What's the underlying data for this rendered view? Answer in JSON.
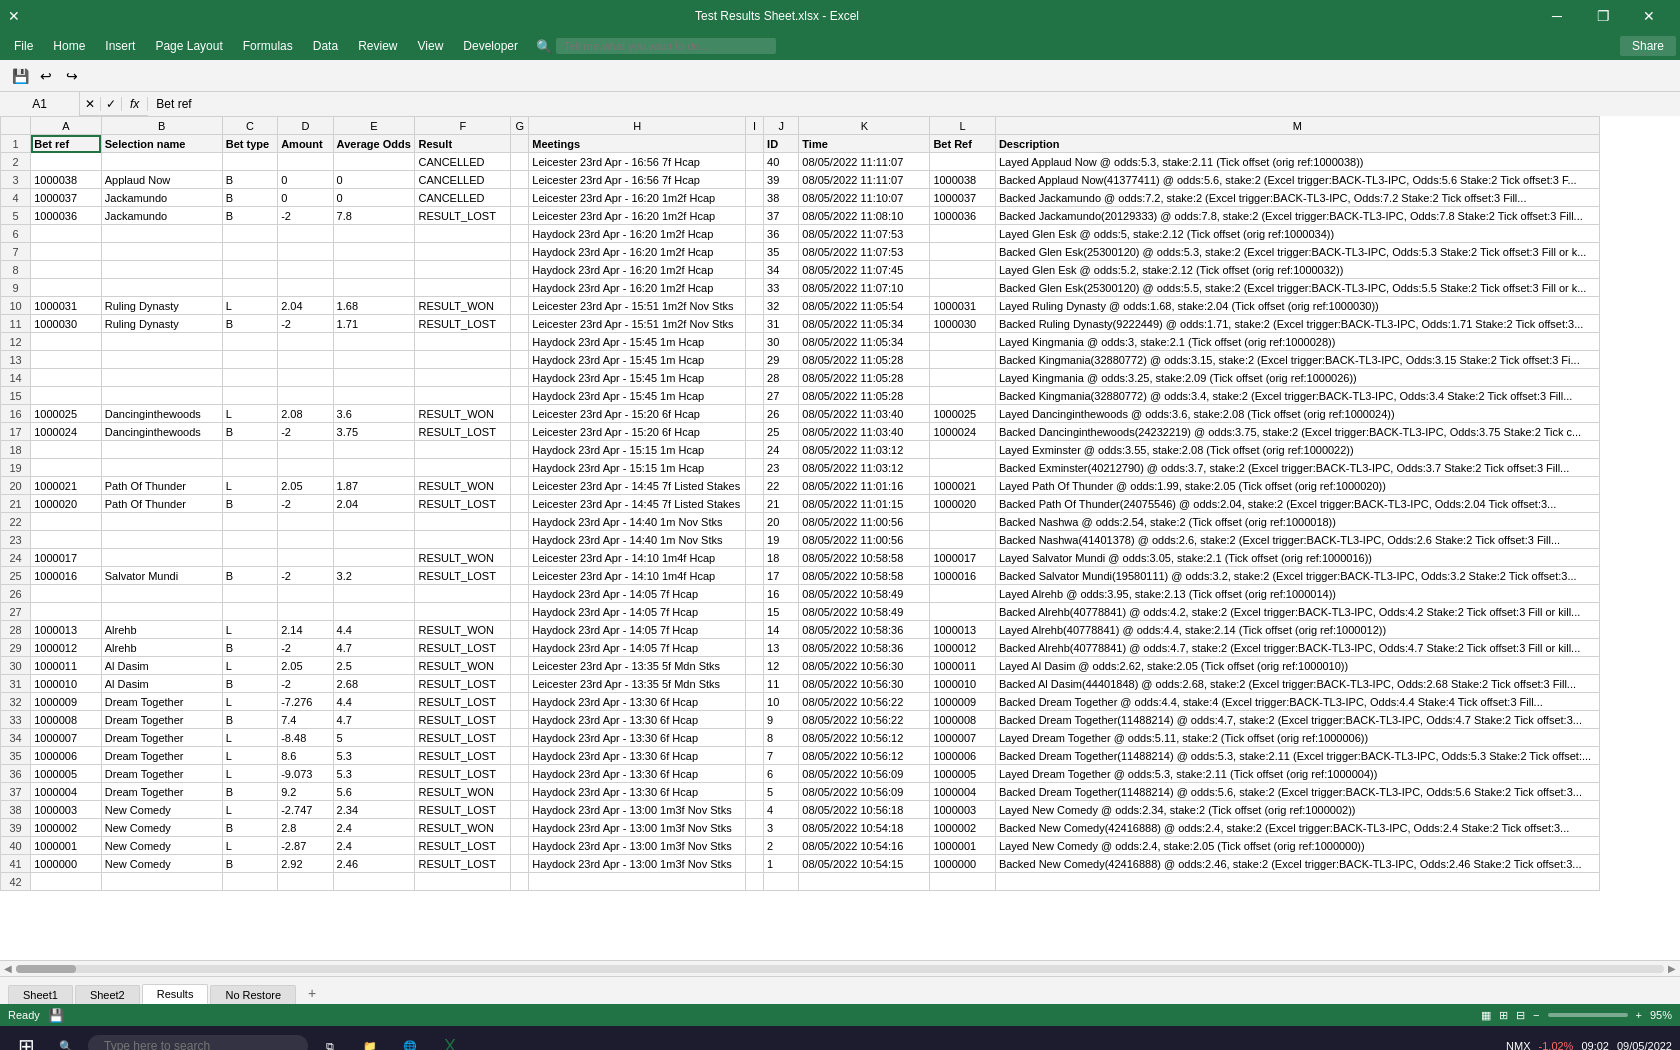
{
  "titleBar": {
    "title": "Test Results Sheet.xlsx - Excel",
    "closeBtn": "✕",
    "maxBtn": "❐",
    "minBtn": "─",
    "restoreBtn": "❒"
  },
  "menuBar": {
    "items": [
      "File",
      "Home",
      "Insert",
      "Page Layout",
      "Formulas",
      "Data",
      "Review",
      "View",
      "Developer"
    ],
    "searchPlaceholder": "Tell me what you want to do...",
    "shareBtn": "Share"
  },
  "formulaBar": {
    "cellRef": "A1",
    "formula": "Bet ref"
  },
  "sheetTabs": {
    "tabs": [
      "Sheet1",
      "Sheet2",
      "Results",
      "No Restore"
    ],
    "active": "Results",
    "addBtn": "+"
  },
  "statusBar": {
    "left": "Ready",
    "zoom": "95%"
  },
  "columns": {
    "headers": [
      "A",
      "B",
      "C",
      "D",
      "E",
      "F",
      "G",
      "H",
      "I",
      "J",
      "K",
      "L",
      "M"
    ],
    "labels": [
      "Bet ref",
      "Selection name",
      "Bet type",
      "Amount",
      "Average Odds",
      "Result",
      "",
      "Meetings",
      "",
      "ID",
      "Time",
      "Bet Ref",
      "Description"
    ]
  },
  "rows": [
    {
      "num": 1,
      "A": "Bet ref",
      "B": "Selection name",
      "C": "Bet type",
      "D": "Amount",
      "E": "Average Odds",
      "F": "Result",
      "G": "",
      "H": "Meetings",
      "I": "",
      "J": "ID",
      "K": "Time",
      "L": "Bet Ref",
      "M": "Description",
      "isHeader": true
    },
    {
      "num": 2,
      "A": "",
      "B": "",
      "C": "",
      "D": "",
      "E": "",
      "F": "CANCELLED",
      "G": "",
      "H": "Leicester 23rd Apr - 16:56 7f Hcap",
      "I": "",
      "J": "40",
      "K": "08/05/2022 11:11:07",
      "L": "",
      "M": "Layed Applaud Now @ odds:5.3, stake:2.11 (Tick offset (orig ref:1000038))"
    },
    {
      "num": 3,
      "A": "1000038",
      "B": "Applaud Now",
      "C": "B",
      "D": "0",
      "E": "0",
      "F": "CANCELLED",
      "G": "",
      "H": "Leicester 23rd Apr - 16:56 7f Hcap",
      "I": "",
      "J": "39",
      "K": "08/05/2022 11:11:07",
      "L": "1000038",
      "M": "Backed Applaud Now(41377411) @ odds:5.6, stake:2 (Excel trigger:BACK-TL3-IPC, Odds:5.6 Stake:2 Tick offset:3 F..."
    },
    {
      "num": 4,
      "A": "1000037",
      "B": "Jackamundo",
      "C": "B",
      "D": "0",
      "E": "0",
      "F": "CANCELLED",
      "G": "",
      "H": "Leicester 23rd Apr - 16:20 1m2f Hcap",
      "I": "",
      "J": "38",
      "K": "08/05/2022 11:10:07",
      "L": "1000037",
      "M": "Backed Jackamundo @ odds:7.2, stake:2 (Excel trigger:BACK-TL3-IPC, Odds:7.2 Stake:2 Tick offset:3 Fill..."
    },
    {
      "num": 5,
      "A": "1000036",
      "B": "Jackamundo",
      "C": "B",
      "D": "-2",
      "E": "7.8",
      "F": "RESULT_LOST",
      "G": "",
      "H": "Leicester 23rd Apr - 16:20 1m2f Hcap",
      "I": "",
      "J": "37",
      "K": "08/05/2022 11:08:10",
      "L": "1000036",
      "M": "Backed Jackamundo(20129333) @ odds:7.8, stake:2 (Excel trigger:BACK-TL3-IPC, Odds:7.8 Stake:2 Tick offset:3 Fill..."
    },
    {
      "num": 6,
      "A": "",
      "B": "",
      "C": "",
      "D": "",
      "E": "",
      "F": "",
      "G": "",
      "H": "Haydock 23rd Apr - 16:20 1m2f Hcap",
      "I": "",
      "J": "36",
      "K": "08/05/2022 11:07:53",
      "L": "",
      "M": "Layed Glen Esk @ odds:5, stake:2.12 (Tick offset (orig ref:1000034))"
    },
    {
      "num": 7,
      "A": "",
      "B": "",
      "C": "",
      "D": "",
      "E": "",
      "F": "",
      "G": "",
      "H": "Haydock 23rd Apr - 16:20 1m2f Hcap",
      "I": "",
      "J": "35",
      "K": "08/05/2022 11:07:53",
      "L": "",
      "M": "Backed Glen Esk(25300120) @ odds:5.3, stake:2 (Excel trigger:BACK-TL3-IPC, Odds:5.3 Stake:2 Tick offset:3 Fill or k..."
    },
    {
      "num": 8,
      "A": "",
      "B": "",
      "C": "",
      "D": "",
      "E": "",
      "F": "",
      "G": "",
      "H": "Haydock 23rd Apr - 16:20 1m2f Hcap",
      "I": "",
      "J": "34",
      "K": "08/05/2022 11:07:45",
      "L": "",
      "M": "Layed Glen Esk @ odds:5.2, stake:2.12 (Tick offset (orig ref:1000032))"
    },
    {
      "num": 9,
      "A": "",
      "B": "",
      "C": "",
      "D": "",
      "E": "",
      "F": "",
      "G": "",
      "H": "Haydock 23rd Apr - 16:20 1m2f Hcap",
      "I": "",
      "J": "33",
      "K": "08/05/2022 11:07:10",
      "L": "",
      "M": "Backed Glen Esk(25300120) @ odds:5.5, stake:2 (Excel trigger:BACK-TL3-IPC, Odds:5.5 Stake:2 Tick offset:3 Fill or k..."
    },
    {
      "num": 10,
      "A": "1000031",
      "B": "Ruling Dynasty",
      "C": "L",
      "D": "2.04",
      "E": "1.68",
      "F": "RESULT_WON",
      "G": "",
      "H": "Leicester 23rd Apr - 15:51 1m2f Nov Stks",
      "I": "",
      "J": "32",
      "K": "08/05/2022 11:05:54",
      "L": "1000031",
      "M": "Layed Ruling Dynasty @ odds:1.68, stake:2.04 (Tick offset (orig ref:1000030))"
    },
    {
      "num": 11,
      "A": "1000030",
      "B": "Ruling Dynasty",
      "C": "B",
      "D": "-2",
      "E": "1.71",
      "F": "RESULT_LOST",
      "G": "",
      "H": "Leicester 23rd Apr - 15:51 1m2f Nov Stks",
      "I": "",
      "J": "31",
      "K": "08/05/2022 11:05:34",
      "L": "1000030",
      "M": "Backed Ruling Dynasty(9222449) @ odds:1.71, stake:2 (Excel trigger:BACK-TL3-IPC, Odds:1.71 Stake:2 Tick offset:3..."
    },
    {
      "num": 12,
      "A": "",
      "B": "",
      "C": "",
      "D": "",
      "E": "",
      "F": "",
      "G": "",
      "H": "Haydock 23rd Apr - 15:45 1m Hcap",
      "I": "",
      "J": "30",
      "K": "08/05/2022 11:05:34",
      "L": "",
      "M": "Layed Kingmania @ odds:3, stake:2.1 (Tick offset (orig ref:1000028))"
    },
    {
      "num": 13,
      "A": "",
      "B": "",
      "C": "",
      "D": "",
      "E": "",
      "F": "",
      "G": "",
      "H": "Haydock 23rd Apr - 15:45 1m Hcap",
      "I": "",
      "J": "29",
      "K": "08/05/2022 11:05:28",
      "L": "",
      "M": "Backed Kingmania(32880772) @ odds:3.15, stake:2 (Excel trigger:BACK-TL3-IPC, Odds:3.15 Stake:2 Tick offset:3 Fi..."
    },
    {
      "num": 14,
      "A": "",
      "B": "",
      "C": "",
      "D": "",
      "E": "",
      "F": "",
      "G": "",
      "H": "Haydock 23rd Apr - 15:45 1m Hcap",
      "I": "",
      "J": "28",
      "K": "08/05/2022 11:05:28",
      "L": "",
      "M": "Layed Kingmania @ odds:3.25, stake:2.09 (Tick offset (orig ref:1000026))"
    },
    {
      "num": 15,
      "A": "",
      "B": "",
      "C": "",
      "D": "",
      "E": "",
      "F": "",
      "G": "",
      "H": "Haydock 23rd Apr - 15:45 1m Hcap",
      "I": "",
      "J": "27",
      "K": "08/05/2022 11:05:28",
      "L": "",
      "M": "Backed Kingmania(32880772) @ odds:3.4, stake:2 (Excel trigger:BACK-TL3-IPC, Odds:3.4 Stake:2 Tick offset:3 Fill..."
    },
    {
      "num": 16,
      "A": "1000025",
      "B": "Dancinginthewoods",
      "C": "L",
      "D": "2.08",
      "E": "3.6",
      "F": "RESULT_WON",
      "G": "",
      "H": "Leicester 23rd Apr - 15:20 6f Hcap",
      "I": "",
      "J": "26",
      "K": "08/05/2022 11:03:40",
      "L": "1000025",
      "M": "Layed Dancinginthewoods @ odds:3.6, stake:2.08 (Tick offset (orig ref:1000024))"
    },
    {
      "num": 17,
      "A": "1000024",
      "B": "Dancinginthewoods",
      "C": "B",
      "D": "-2",
      "E": "3.75",
      "F": "RESULT_LOST",
      "G": "",
      "H": "Leicester 23rd Apr - 15:20 6f Hcap",
      "I": "",
      "J": "25",
      "K": "08/05/2022 11:03:40",
      "L": "1000024",
      "M": "Backed Dancinginthewoods(24232219) @ odds:3.75, stake:2 (Excel trigger:BACK-TL3-IPC, Odds:3.75 Stake:2 Tick c..."
    },
    {
      "num": 18,
      "A": "",
      "B": "",
      "C": "",
      "D": "",
      "E": "",
      "F": "",
      "G": "",
      "H": "Haydock 23rd Apr - 15:15 1m Hcap",
      "I": "",
      "J": "24",
      "K": "08/05/2022 11:03:12",
      "L": "",
      "M": "Layed Exminster @ odds:3.55, stake:2.08 (Tick offset (orig ref:1000022))"
    },
    {
      "num": 19,
      "A": "",
      "B": "",
      "C": "",
      "D": "",
      "E": "",
      "F": "",
      "G": "",
      "H": "Haydock 23rd Apr - 15:15 1m Hcap",
      "I": "",
      "J": "23",
      "K": "08/05/2022 11:03:12",
      "L": "",
      "M": "Backed Exminster(40212790) @ odds:3.7, stake:2 (Excel trigger:BACK-TL3-IPC, Odds:3.7 Stake:2 Tick offset:3 Fill..."
    },
    {
      "num": 20,
      "A": "1000021",
      "B": "Path Of Thunder",
      "C": "L",
      "D": "2.05",
      "E": "1.87",
      "F": "RESULT_WON",
      "G": "",
      "H": "Leicester 23rd Apr - 14:45 7f Listed Stakes",
      "I": "",
      "J": "22",
      "K": "08/05/2022 11:01:16",
      "L": "1000021",
      "M": "Layed Path Of Thunder @ odds:1.99, stake:2.05 (Tick offset (orig ref:1000020))"
    },
    {
      "num": 21,
      "A": "1000020",
      "B": "Path Of Thunder",
      "C": "B",
      "D": "-2",
      "E": "2.04",
      "F": "RESULT_LOST",
      "G": "",
      "H": "Leicester 23rd Apr - 14:45 7f Listed Stakes",
      "I": "",
      "J": "21",
      "K": "08/05/2022 11:01:15",
      "L": "1000020",
      "M": "Backed Path Of Thunder(24075546) @ odds:2.04, stake:2 (Excel trigger:BACK-TL3-IPC, Odds:2.04 Tick offset:3..."
    },
    {
      "num": 22,
      "A": "",
      "B": "",
      "C": "",
      "D": "",
      "E": "",
      "F": "",
      "G": "",
      "H": "Haydock 23rd Apr - 14:40 1m Nov Stks",
      "I": "",
      "J": "20",
      "K": "08/05/2022 11:00:56",
      "L": "",
      "M": "Backed Nashwa @ odds:2.54, stake:2 (Tick offset (orig ref:1000018))"
    },
    {
      "num": 23,
      "A": "",
      "B": "",
      "C": "",
      "D": "",
      "E": "",
      "F": "",
      "G": "",
      "H": "Haydock 23rd Apr - 14:40 1m Nov Stks",
      "I": "",
      "J": "19",
      "K": "08/05/2022 11:00:56",
      "L": "",
      "M": "Backed Nashwa(41401378) @ odds:2.6, stake:2 (Excel trigger:BACK-TL3-IPC, Odds:2.6 Stake:2 Tick offset:3 Fill..."
    },
    {
      "num": 24,
      "A": "1000017",
      "B": "",
      "C": "",
      "D": "",
      "E": "",
      "F": "RESULT_WON",
      "G": "",
      "H": "Leicester 23rd Apr - 14:10 1m4f Hcap",
      "I": "",
      "J": "18",
      "K": "08/05/2022 10:58:58",
      "L": "1000017",
      "M": "Layed Salvator Mundi @ odds:3.05, stake:2.1 (Tick offset (orig ref:1000016))"
    },
    {
      "num": 25,
      "A": "1000016",
      "B": "Salvator Mundi",
      "C": "B",
      "D": "-2",
      "E": "3.2",
      "F": "RESULT_LOST",
      "G": "",
      "H": "Leicester 23rd Apr - 14:10 1m4f Hcap",
      "I": "",
      "J": "17",
      "K": "08/05/2022 10:58:58",
      "L": "1000016",
      "M": "Backed Salvator Mundi(19580111) @ odds:3.2, stake:2 (Excel trigger:BACK-TL3-IPC, Odds:3.2 Stake:2 Tick offset:3..."
    },
    {
      "num": 26,
      "A": "",
      "B": "",
      "C": "",
      "D": "",
      "E": "",
      "F": "",
      "G": "",
      "H": "Haydock 23rd Apr - 14:05 7f Hcap",
      "I": "",
      "J": "16",
      "K": "08/05/2022 10:58:49",
      "L": "",
      "M": "Layed Alrehb @ odds:3.95, stake:2.13 (Tick offset (orig ref:1000014))"
    },
    {
      "num": 27,
      "A": "",
      "B": "",
      "C": "",
      "D": "",
      "E": "",
      "F": "",
      "G": "",
      "H": "Haydock 23rd Apr - 14:05 7f Hcap",
      "I": "",
      "J": "15",
      "K": "08/05/2022 10:58:49",
      "L": "",
      "M": "Backed Alrehb(40778841) @ odds:4.2, stake:2 (Excel trigger:BACK-TL3-IPC, Odds:4.2 Stake:2 Tick offset:3 Fill or kill..."
    },
    {
      "num": 28,
      "A": "1000013",
      "B": "Alrehb",
      "C": "L",
      "D": "2.14",
      "E": "4.4",
      "F": "RESULT_WON",
      "G": "",
      "H": "Haydock 23rd Apr - 14:05 7f Hcap",
      "I": "",
      "J": "14",
      "K": "08/05/2022 10:58:36",
      "L": "1000013",
      "M": "Layed Alrehb(40778841) @ odds:4.4, stake:2.14 (Tick offset (orig ref:1000012))"
    },
    {
      "num": 29,
      "A": "1000012",
      "B": "Alrehb",
      "C": "B",
      "D": "-2",
      "E": "4.7",
      "F": "RESULT_LOST",
      "G": "",
      "H": "Haydock 23rd Apr - 14:05 7f Hcap",
      "I": "",
      "J": "13",
      "K": "08/05/2022 10:58:36",
      "L": "1000012",
      "M": "Backed Alrehb(40778841) @ odds:4.7, stake:2 (Excel trigger:BACK-TL3-IPC, Odds:4.7 Stake:2 Tick offset:3 Fill or kill..."
    },
    {
      "num": 30,
      "A": "1000011",
      "B": "Al Dasim",
      "C": "L",
      "D": "2.05",
      "E": "2.5",
      "F": "RESULT_WON",
      "G": "",
      "H": "Leicester 23rd Apr - 13:35 5f Mdn Stks",
      "I": "",
      "J": "12",
      "K": "08/05/2022 10:56:30",
      "L": "1000011",
      "M": "Layed Al Dasim @ odds:2.62, stake:2.05 (Tick offset (orig ref:1000010))"
    },
    {
      "num": 31,
      "A": "1000010",
      "B": "Al Dasim",
      "C": "B",
      "D": "-2",
      "E": "2.68",
      "F": "RESULT_LOST",
      "G": "",
      "H": "Leicester 23rd Apr - 13:35 5f Mdn Stks",
      "I": "",
      "J": "11",
      "K": "08/05/2022 10:56:30",
      "L": "1000010",
      "M": "Backed Al Dasim(44401848) @ odds:2.68, stake:2 (Excel trigger:BACK-TL3-IPC, Odds:2.68 Stake:2 Tick offset:3 Fill..."
    },
    {
      "num": 32,
      "A": "1000009",
      "B": "Dream Together",
      "C": "L",
      "D": "-7.276",
      "E": "4.4",
      "F": "RESULT_LOST",
      "G": "",
      "H": "Haydock 23rd Apr - 13:30 6f Hcap",
      "I": "",
      "J": "10",
      "K": "08/05/2022 10:56:22",
      "L": "1000009",
      "M": "Backed Dream Together @ odds:4.4, stake:4 (Excel trigger:BACK-TL3-IPC, Odds:4.4 Stake:4 Tick offset:3 Fill..."
    },
    {
      "num": 33,
      "A": "1000008",
      "B": "Dream Together",
      "C": "B",
      "D": "7.4",
      "E": "4.7",
      "F": "RESULT_LOST",
      "G": "",
      "H": "Haydock 23rd Apr - 13:30 6f Hcap",
      "I": "",
      "J": "9",
      "K": "08/05/2022 10:56:22",
      "L": "1000008",
      "M": "Backed Dream Together(11488214) @ odds:4.7, stake:2 (Excel trigger:BACK-TL3-IPC, Odds:4.7 Stake:2 Tick offset:3..."
    },
    {
      "num": 34,
      "A": "1000007",
      "B": "Dream Together",
      "C": "L",
      "D": "-8.48",
      "E": "5",
      "F": "RESULT_LOST",
      "G": "",
      "H": "Haydock 23rd Apr - 13:30 6f Hcap",
      "I": "",
      "J": "8",
      "K": "08/05/2022 10:56:12",
      "L": "1000007",
      "M": "Layed Dream Together @ odds:5.11, stake:2 (Tick offset (orig ref:1000006))"
    },
    {
      "num": 35,
      "A": "1000006",
      "B": "Dream Together",
      "C": "L",
      "D": "8.6",
      "E": "5.3",
      "F": "RESULT_LOST",
      "G": "",
      "H": "Haydock 23rd Apr - 13:30 6f Hcap",
      "I": "",
      "J": "7",
      "K": "08/05/2022 10:56:12",
      "L": "1000006",
      "M": "Backed Dream Together(11488214) @ odds:5.3, stake:2.11 (Excel trigger:BACK-TL3-IPC, Odds:5.3 Stake:2 Tick offset:..."
    },
    {
      "num": 36,
      "A": "1000005",
      "B": "Dream Together",
      "C": "L",
      "D": "-9.073",
      "E": "5.3",
      "F": "RESULT_LOST",
      "G": "",
      "H": "Haydock 23rd Apr - 13:30 6f Hcap",
      "I": "",
      "J": "6",
      "K": "08/05/2022 10:56:09",
      "L": "1000005",
      "M": "Layed Dream Together @ odds:5.3, stake:2.11 (Tick offset (orig ref:1000004))"
    },
    {
      "num": 37,
      "A": "1000004",
      "B": "Dream Together",
      "C": "B",
      "D": "9.2",
      "E": "5.6",
      "F": "RESULT_WON",
      "G": "",
      "H": "Haydock 23rd Apr - 13:30 6f Hcap",
      "I": "",
      "J": "5",
      "K": "08/05/2022 10:56:09",
      "L": "1000004",
      "M": "Backed Dream Together(11488214) @ odds:5.6, stake:2 (Excel trigger:BACK-TL3-IPC, Odds:5.6 Stake:2 Tick offset:3..."
    },
    {
      "num": 38,
      "A": "1000003",
      "B": "New Comedy",
      "C": "L",
      "D": "-2.747",
      "E": "2.34",
      "F": "RESULT_LOST",
      "G": "",
      "H": "Haydock 23rd Apr - 13:00 1m3f Nov Stks",
      "I": "",
      "J": "4",
      "K": "08/05/2022 10:56:18",
      "L": "1000003",
      "M": "Layed New Comedy @ odds:2.34, stake:2 (Tick offset (orig ref:1000002))"
    },
    {
      "num": 39,
      "A": "1000002",
      "B": "New Comedy",
      "C": "B",
      "D": "2.8",
      "E": "2.4",
      "F": "RESULT_WON",
      "G": "",
      "H": "Haydock 23rd Apr - 13:00 1m3f Nov Stks",
      "I": "",
      "J": "3",
      "K": "08/05/2022 10:54:18",
      "L": "1000002",
      "M": "Backed New Comedy(42416888) @ odds:2.4, stake:2 (Excel trigger:BACK-TL3-IPC, Odds:2.4 Stake:2 Tick offset:3..."
    },
    {
      "num": 40,
      "A": "1000001",
      "B": "New Comedy",
      "C": "L",
      "D": "-2.87",
      "E": "2.4",
      "F": "RESULT_LOST",
      "G": "",
      "H": "Haydock 23rd Apr - 13:00 1m3f Nov Stks",
      "I": "",
      "J": "2",
      "K": "08/05/2022 10:54:16",
      "L": "1000001",
      "M": "Layed New Comedy @ odds:2.4, stake:2.05 (Tick offset (orig ref:1000000))"
    },
    {
      "num": 41,
      "A": "1000000",
      "B": "New Comedy",
      "C": "B",
      "D": "2.92",
      "E": "2.46",
      "F": "RESULT_LOST",
      "G": "",
      "H": "Haydock 23rd Apr - 13:00 1m3f Nov Stks",
      "I": "",
      "J": "1",
      "K": "08/05/2022 10:54:15",
      "L": "1000000",
      "M": "Backed New Comedy(42416888) @ odds:2.46, stake:2 (Excel trigger:BACK-TL3-IPC, Odds:2.46 Stake:2 Tick offset:3..."
    },
    {
      "num": 42,
      "A": "",
      "B": "",
      "C": "",
      "D": "",
      "E": "",
      "F": "",
      "G": "",
      "H": "",
      "I": "",
      "J": "",
      "K": "",
      "L": "",
      "M": ""
    }
  ],
  "taskbar": {
    "time": "09:02",
    "date": "09/05/2022",
    "nmxLabel": "NMX",
    "nmxValue": "-1.02%"
  }
}
